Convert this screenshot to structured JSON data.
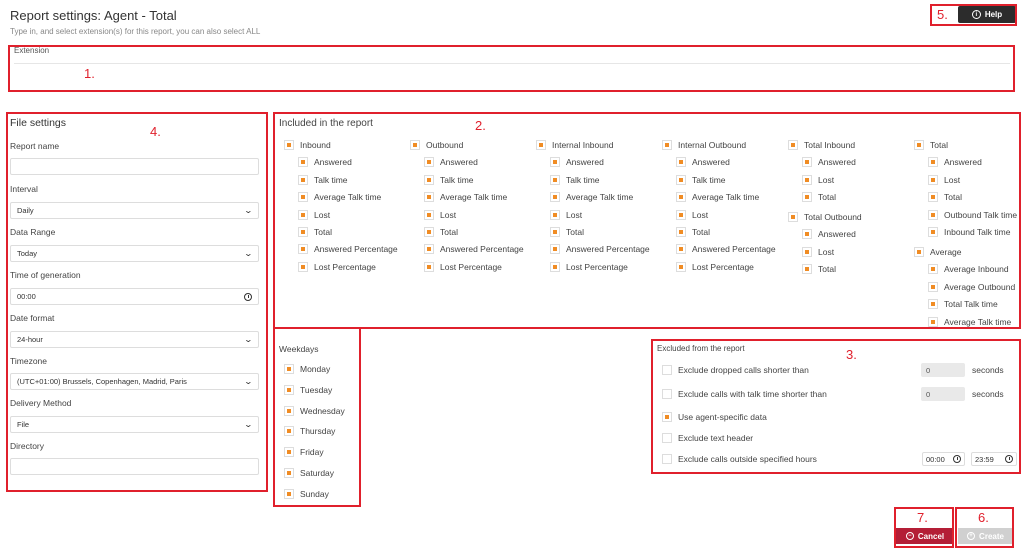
{
  "header": {
    "title": "Report settings: Agent - Total",
    "subtitle": "Type in, and select extension(s) for this report, you can also select ALL",
    "help_label": "Help"
  },
  "extension": {
    "label": "Extension",
    "value": ""
  },
  "file_settings": {
    "title": "File settings",
    "report_name_label": "Report name",
    "report_name_value": "",
    "interval_label": "Interval",
    "interval_value": "Daily",
    "data_range_label": "Data Range",
    "data_range_value": "Today",
    "time_of_generation_label": "Time of generation",
    "time_of_generation_value": "00:00",
    "date_format_label": "Date format",
    "date_format_value": "24-hour",
    "timezone_label": "Timezone",
    "timezone_value": "(UTC+01:00) Brussels, Copenhagen, Madrid, Paris",
    "delivery_method_label": "Delivery Method",
    "delivery_method_value": "File",
    "directory_label": "Directory",
    "directory_value": ""
  },
  "included": {
    "title": "Included in the report",
    "inbound": {
      "label": "Inbound",
      "items": [
        "Answered",
        "Talk time",
        "Average Talk time",
        "Lost",
        "Total",
        "Answered Percentage",
        "Lost Percentage"
      ]
    },
    "outbound": {
      "label": "Outbound",
      "items": [
        "Answered",
        "Talk time",
        "Average Talk time",
        "Lost",
        "Total",
        "Answered Percentage",
        "Lost Percentage"
      ]
    },
    "internal_inbound": {
      "label": "Internal Inbound",
      "items": [
        "Answered",
        "Talk time",
        "Average Talk time",
        "Lost",
        "Total",
        "Answered Percentage",
        "Lost Percentage"
      ]
    },
    "internal_outbound": {
      "label": "Internal Outbound",
      "items": [
        "Answered",
        "Talk time",
        "Average Talk time",
        "Lost",
        "Total",
        "Answered Percentage",
        "Lost Percentage"
      ]
    },
    "total_inbound": {
      "label": "Total Inbound",
      "items": [
        "Answered",
        "Lost",
        "Total"
      ]
    },
    "total_outbound": {
      "label": "Total Outbound",
      "items": [
        "Answered",
        "Lost",
        "Total"
      ]
    },
    "total": {
      "label": "Total",
      "items": [
        "Answered",
        "Lost",
        "Total",
        "Outbound Talk time",
        "Inbound Talk time"
      ]
    },
    "average": {
      "label": "Average",
      "items": [
        "Average Inbound",
        "Average Outbound",
        "Total Talk time",
        "Average Talk time"
      ]
    }
  },
  "weekdays": {
    "title": "Weekdays",
    "days": [
      "Monday",
      "Tuesday",
      "Wednesday",
      "Thursday",
      "Friday",
      "Saturday",
      "Sunday"
    ]
  },
  "excluded": {
    "title": "Excluded from the report",
    "dropped_label": "Exclude dropped calls shorter than",
    "dropped_value": "0",
    "talk_label": "Exclude calls with talk time shorter than",
    "talk_value": "0",
    "seconds_label": "seconds",
    "agent_specific_label": "Use agent-specific data",
    "text_header_label": "Exclude text header",
    "outside_hours_label": "Exclude calls outside specified hours",
    "from_time": "00:00",
    "to_time": "23:59"
  },
  "footer": {
    "cancel_label": "Cancel",
    "create_label": "Create"
  },
  "annotations": [
    "1.",
    "2.",
    "3.",
    "4.",
    "5.",
    "6.",
    "7."
  ],
  "colors": {
    "accent": "#f08c24",
    "annotation": "#e0202c",
    "cancel": "#b41e36",
    "help": "#2c2c2c"
  }
}
